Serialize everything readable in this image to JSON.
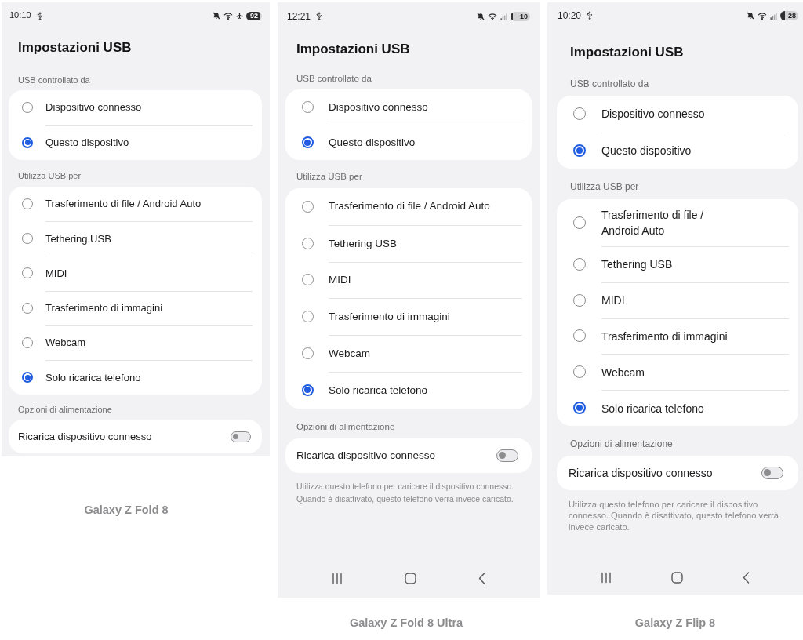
{
  "phones": [
    {
      "status_bar": {
        "time": "10:10",
        "battery": "92",
        "airplane_mode": true
      },
      "title": "Impostazioni USB",
      "sections": [
        {
          "label": "USB controllato da",
          "kind": "radio",
          "options": [
            {
              "label": "Dispositivo connesso",
              "selected": false
            },
            {
              "label": "Questo dispositivo",
              "selected": true
            }
          ]
        },
        {
          "label": "Utilizza USB per",
          "kind": "radio",
          "options": [
            {
              "label": "Trasferimento di file / Android Auto",
              "selected": false
            },
            {
              "label": "Tethering USB",
              "selected": false
            },
            {
              "label": "MIDI",
              "selected": false
            },
            {
              "label": "Trasferimento di immagini",
              "selected": false
            },
            {
              "label": "Webcam",
              "selected": false
            },
            {
              "label": "Solo ricarica telefono",
              "selected": true
            }
          ]
        },
        {
          "label": "Opzioni di alimentazione",
          "kind": "toggle",
          "options": [
            {
              "label": "Ricarica dispositivo connesso",
              "on": false
            }
          ]
        }
      ],
      "caption": "Galaxy Z Fold 8"
    },
    {
      "status_bar": {
        "time": "12:21",
        "battery": "10",
        "airplane_mode": false
      },
      "title": "Impostazioni USB",
      "sections": [
        {
          "label": "USB controllato da",
          "kind": "radio",
          "options": [
            {
              "label": "Dispositivo connesso",
              "selected": false
            },
            {
              "label": "Questo dispositivo",
              "selected": true
            }
          ]
        },
        {
          "label": "Utilizza USB per",
          "kind": "radio",
          "options": [
            {
              "label": "Trasferimento di file / Android Auto",
              "selected": false
            },
            {
              "label": "Tethering USB",
              "selected": false
            },
            {
              "label": "MIDI",
              "selected": false
            },
            {
              "label": "Trasferimento di immagini",
              "selected": false
            },
            {
              "label": "Webcam",
              "selected": false
            },
            {
              "label": "Solo ricarica telefono",
              "selected": true
            }
          ]
        },
        {
          "label": "Opzioni di alimentazione",
          "kind": "toggle",
          "options": [
            {
              "label": "Ricarica dispositivo connesso",
              "on": false
            }
          ],
          "note": "Utilizza questo telefono per caricare il dispositivo connesso. Quando è disattivato, questo telefono verrà invece caricato."
        }
      ],
      "caption": "Galaxy Z Fold 8 Ultra"
    },
    {
      "status_bar": {
        "time": "10:20",
        "battery": "28",
        "airplane_mode": false
      },
      "title": "Impostazioni USB",
      "sections": [
        {
          "label": "USB controllato da",
          "kind": "radio",
          "options": [
            {
              "label": "Dispositivo connesso",
              "selected": false
            },
            {
              "label": "Questo dispositivo",
              "selected": true
            }
          ]
        },
        {
          "label": "Utilizza USB per",
          "kind": "radio",
          "options": [
            {
              "label": "Trasferimento di file / Android Auto",
              "selected": false
            },
            {
              "label": "Tethering USB",
              "selected": false
            },
            {
              "label": "MIDI",
              "selected": false
            },
            {
              "label": "Trasferimento di immagini",
              "selected": false
            },
            {
              "label": "Webcam",
              "selected": false
            },
            {
              "label": "Solo ricarica telefono",
              "selected": true
            }
          ]
        },
        {
          "label": "Opzioni di alimentazione",
          "kind": "toggle",
          "options": [
            {
              "label": "Ricarica dispositivo connesso",
              "on": false
            }
          ],
          "note": "Utilizza questo telefono per caricare il dispositivo connesso. Quando è disattivato, questo telefono verrà invece caricato."
        }
      ],
      "caption": "Galaxy Z Flip 8"
    }
  ]
}
